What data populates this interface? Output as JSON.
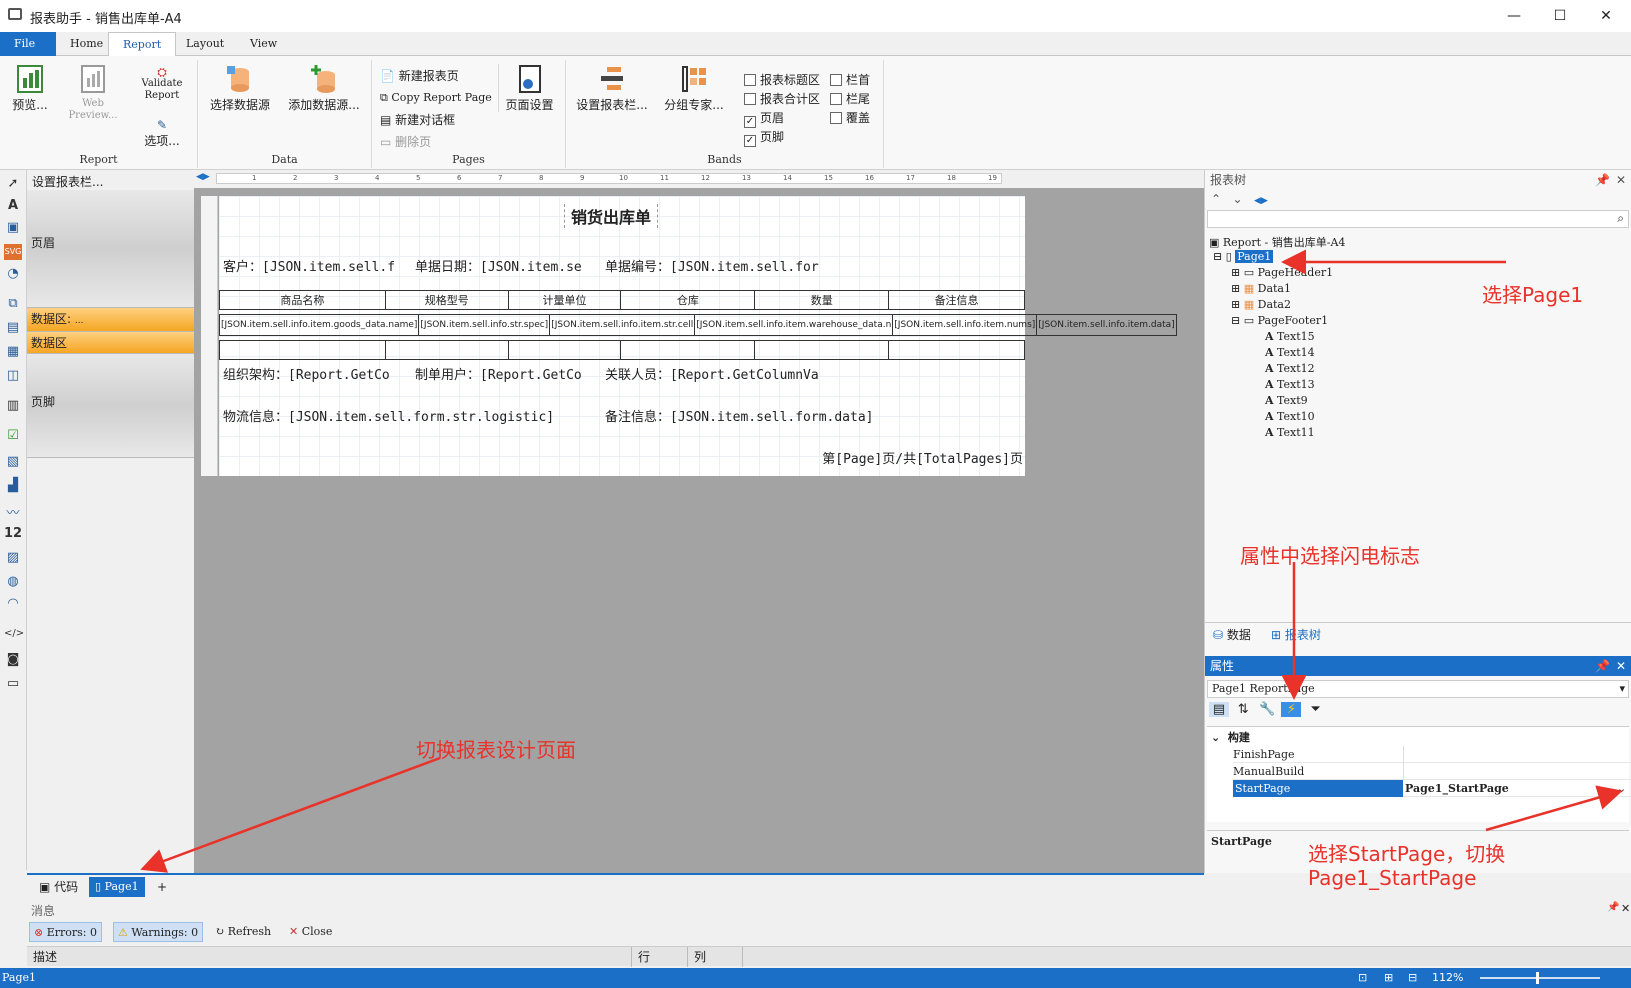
{
  "window": {
    "title": "报表助手 - 销售出库单-A4",
    "minimize": "—",
    "maximize": "☐",
    "close": "✕"
  },
  "menu": {
    "file": "File",
    "home": "Home",
    "report": "Report",
    "layout": "Layout",
    "view": "View"
  },
  "ribbon": {
    "report_group": "Report",
    "preview": "预览...",
    "web_preview": "Web Preview...",
    "validate": "Validate Report",
    "options": "选项...",
    "data_group": "Data",
    "select_ds": "选择数据源",
    "add_ds": "添加数据源...",
    "pages_group": "Pages",
    "new_page": "新建报表页",
    "copy_page": "Copy Report Page",
    "new_dialog": "新建对话框",
    "delete_page": "删除页",
    "page_setup": "页面设置",
    "bands_group": "Bands",
    "set_bands": "设置报表栏...",
    "group_expert": "分组专家...",
    "cb_title": "报表标题区",
    "cb_summary": "报表合计区",
    "cb_header": "页眉",
    "cb_footer": "页脚",
    "cb_colhead": "栏首",
    "cb_colfoot": "栏尾",
    "cb_overlay": "覆盖",
    "check_mark": "✓"
  },
  "bands": {
    "setup": "设置报表栏...",
    "header": "页眉",
    "data1": "数据区:",
    "data1_sub": "...",
    "data2": "数据区",
    "footer": "页脚"
  },
  "ruler": {
    "t1": "1",
    "t2": "2",
    "t3": "3",
    "t4": "4",
    "t5": "5",
    "t6": "6",
    "t7": "7",
    "t8": "8",
    "t9": "9",
    "t10": "10",
    "t11": "11",
    "t12": "12",
    "t13": "13",
    "t14": "14",
    "t15": "15",
    "t16": "16",
    "t17": "17",
    "t18": "18",
    "t19": "19"
  },
  "report": {
    "title": "销货出库单",
    "customer": "客户：[JSON.item.sell.f",
    "doc_date": "单据日期：[JSON.item.se",
    "doc_no": "单据编号：[JSON.item.sell.for",
    "headers": [
      "商品名称",
      "规格型号",
      "计量单位",
      "仓库",
      "数量",
      "备注信息"
    ],
    "cells": [
      "[JSON.item.sell.info.item.goods_data.name]",
      "[JSON.item.sell.info.str.spec]",
      "[JSON.item.sell.info.item.str.cell",
      "[JSON.item.sell.info.item.warehouse_data.n",
      "[JSON.item.sell.info.item.nums]",
      "[JSON.item.sell.info.item.data]"
    ],
    "org": "组织架构：[Report.GetCo",
    "maker": "制单用户：[Report.GetCo",
    "related": "关联人员：[Report.GetColumnVa",
    "logistics": "物流信息：[JSON.item.sell.form.str.logistic]",
    "remark": "备注信息：[JSON.item.sell.form.data]",
    "pager": "第[Page]页/共[TotalPages]页"
  },
  "pagetabs": {
    "code": "代码",
    "page1": "Page1",
    "add": "+"
  },
  "tree": {
    "header": "报表树",
    "root": "Report - 销售出库单-A4",
    "page1": "Page1",
    "pageheader": "PageHeader1",
    "data1": "Data1",
    "data2": "Data2",
    "pagefooter": "PageFooter1",
    "texts": [
      "Text15",
      "Text14",
      "Text12",
      "Text13",
      "Text9",
      "Text10",
      "Text11"
    ],
    "tab_data": "数据",
    "tab_tree": "报表树"
  },
  "props": {
    "header": "属性",
    "object": "Page1 ReportPage",
    "section": "构建",
    "rows": [
      {
        "name": "FinishPage",
        "value": ""
      },
      {
        "name": "ManualBuild",
        "value": ""
      },
      {
        "name": "StartPage",
        "value": "Page1_StartPage"
      }
    ],
    "desc_title": "StartPage"
  },
  "messages": {
    "header": "消息",
    "errors": "Errors: 0",
    "warnings": "Warnings: 0",
    "refresh": "Refresh",
    "close": "Close",
    "col_desc": "描述",
    "col_row": "行",
    "col_col": "列"
  },
  "status": {
    "left": "Page1",
    "zoom": "112%"
  },
  "annotations": {
    "a1": "选择Page1",
    "a2": "属性中选择闪电标志",
    "a3": "切换报表设计页面",
    "a4": "选择StartPage，切换",
    "a5": "Page1_StartPage"
  }
}
